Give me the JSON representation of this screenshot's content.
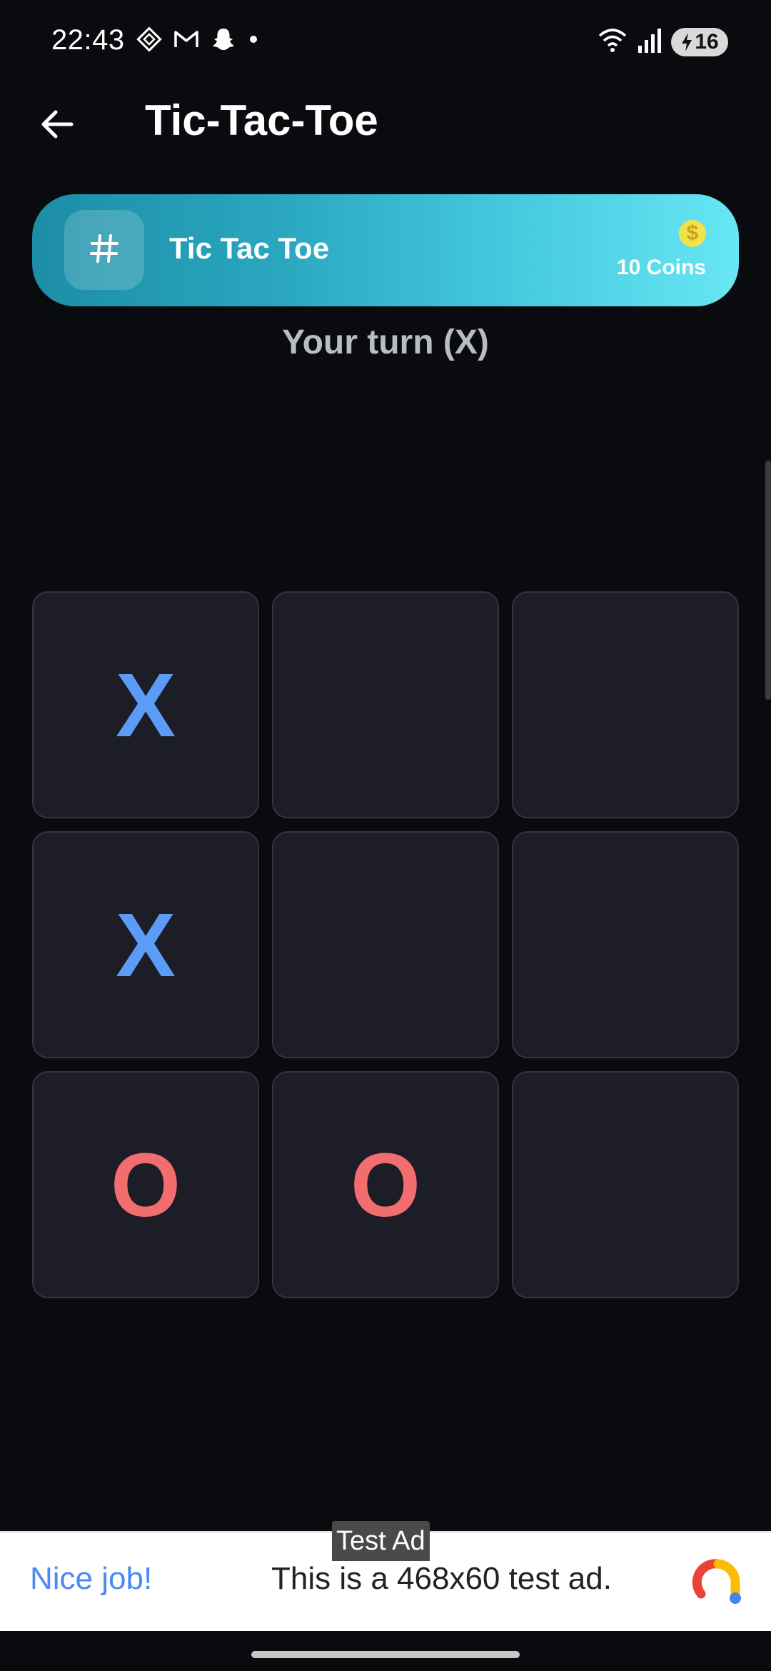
{
  "status_bar": {
    "time": "22:43",
    "battery": "16",
    "left_icons": [
      "diamond-app-icon",
      "gmail-icon",
      "snapchat-icon",
      "dot-icon"
    ],
    "right_icons": [
      "wifi-icon",
      "signal-icon",
      "battery-icon"
    ]
  },
  "app_bar": {
    "title": "Tic-Tac-Toe",
    "back_icon": "back-arrow-icon"
  },
  "game_banner": {
    "icon": "hash-icon",
    "title": "Tic Tac Toe",
    "coin_symbol": "$",
    "coins": "10 Coins",
    "gradient": [
      "#1c8da6",
      "#67e6f4"
    ]
  },
  "status": {
    "turn_text": "Your turn (X)"
  },
  "board": {
    "cells": [
      "X",
      "",
      "",
      "X",
      "",
      "",
      "O",
      "O",
      ""
    ],
    "colors": {
      "x": "#5b9cf6",
      "o": "#f26d6d",
      "cell_bg": "#1c1d27"
    }
  },
  "ad": {
    "label": "Test Ad",
    "left_text": "Nice job!",
    "main_text": "This is a 468x60 test ad."
  }
}
